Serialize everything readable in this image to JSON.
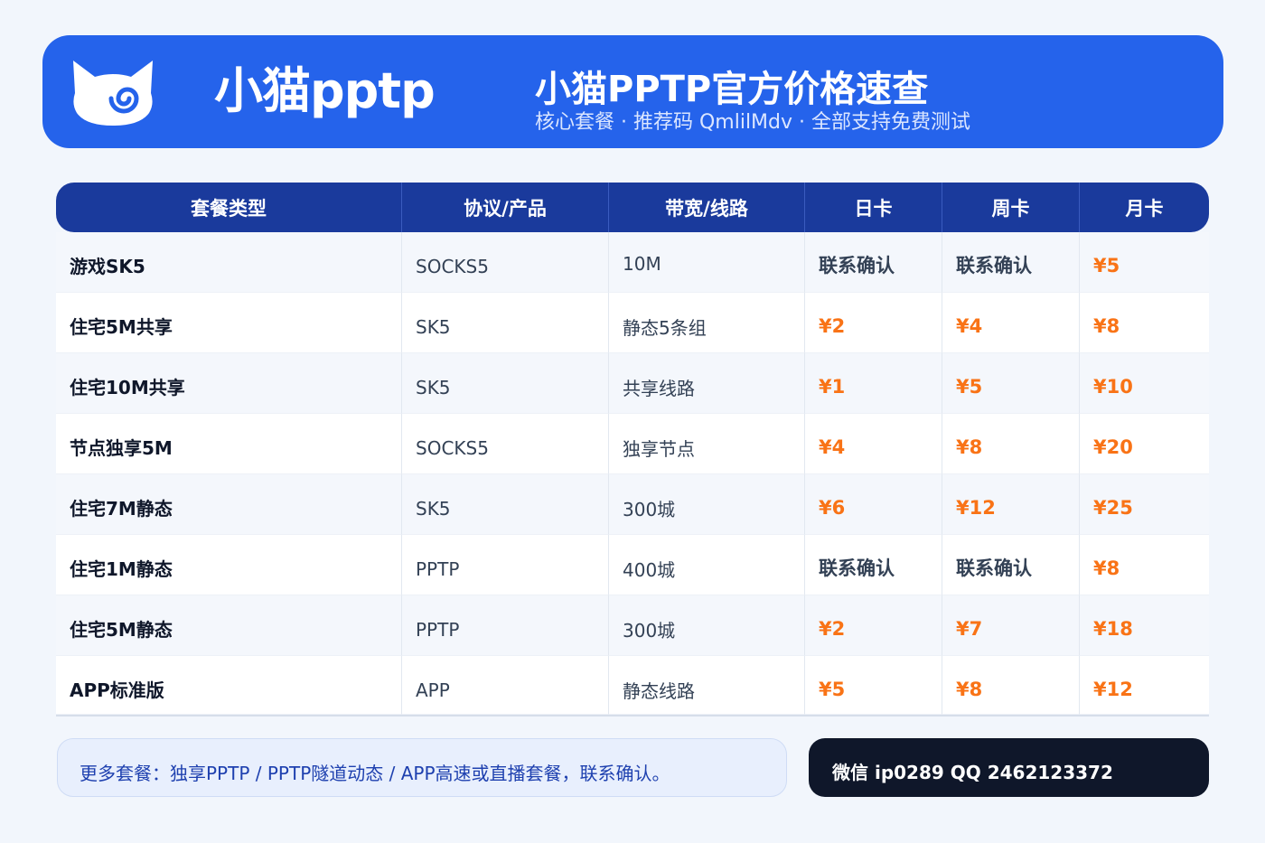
{
  "header": {
    "brand_name": "小猫pptp",
    "title": "小猫PPTP官方价格速查",
    "subtitle": "核心套餐 · 推荐码 QmlilMdv · 全部支持免费测试",
    "logo_icon": "cat-head-icon"
  },
  "colors": {
    "banner_bg": "#2563eb",
    "table_header_bg": "#1a3a9c",
    "price": "#f97316",
    "contact_bg": "#0f172a",
    "page_bg": "#f2f6fc"
  },
  "table": {
    "headers": [
      "套餐类型",
      "协议/产品",
      "带宽/线路",
      "日卡",
      "周卡",
      "月卡"
    ],
    "rows": [
      {
        "name": "游戏SK5",
        "protocol": "SOCKS5",
        "bandwidth": "10M",
        "day": "联系确认",
        "week": "联系确认",
        "month": "¥5"
      },
      {
        "name": "住宅5M共享",
        "protocol": "SK5",
        "bandwidth": "静态5条组",
        "day": "¥2",
        "week": "¥4",
        "month": "¥8"
      },
      {
        "name": "住宅10M共享",
        "protocol": "SK5",
        "bandwidth": "共享线路",
        "day": "¥1",
        "week": "¥5",
        "month": "¥10"
      },
      {
        "name": "节点独享5M",
        "protocol": "SOCKS5",
        "bandwidth": "独享节点",
        "day": "¥4",
        "week": "¥8",
        "month": "¥20"
      },
      {
        "name": "住宅7M静态",
        "protocol": "SK5",
        "bandwidth": "300城",
        "day": "¥6",
        "week": "¥12",
        "month": "¥25"
      },
      {
        "name": "住宅1M静态",
        "protocol": "PPTP",
        "bandwidth": "400城",
        "day": "联系确认",
        "week": "联系确认",
        "month": "¥8"
      },
      {
        "name": "住宅5M静态",
        "protocol": "PPTP",
        "bandwidth": "300城",
        "day": "¥2",
        "week": "¥7",
        "month": "¥18"
      },
      {
        "name": "APP标准版",
        "protocol": "APP",
        "bandwidth": "静态线路",
        "day": "¥5",
        "week": "¥8",
        "month": "¥12"
      }
    ]
  },
  "footer": {
    "note": "更多套餐：独享PPTP / PPTP隧道动态 / APP高速或直播套餐，联系确认。",
    "contact": "微信 ip0289  QQ 2462123372"
  }
}
